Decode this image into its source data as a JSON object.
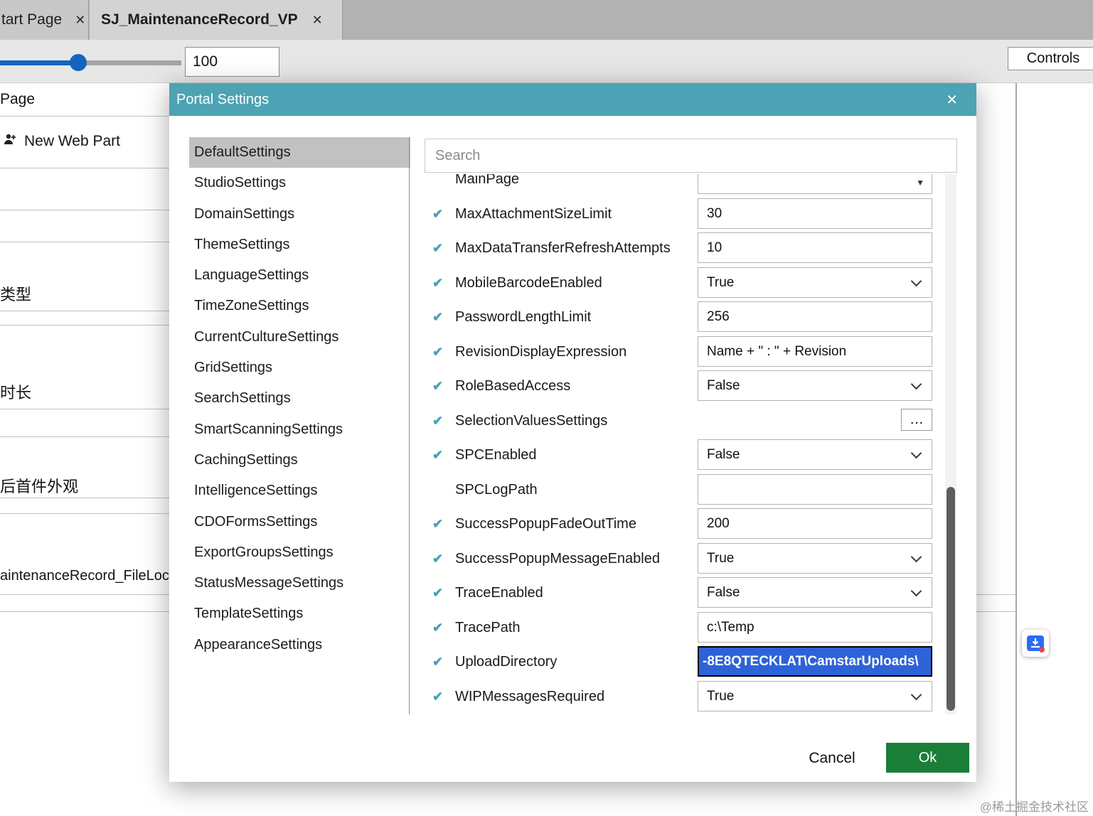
{
  "tabs": [
    {
      "label": "tart Page",
      "active": false
    },
    {
      "label": "SJ_MaintenanceRecord_VP",
      "active": true
    }
  ],
  "toolbar": {
    "zoom_value": "100",
    "controls_label": "Controls"
  },
  "background": {
    "page_label": "Page",
    "new_web_part_label": "New Web Part",
    "type_label": "类型",
    "duration_label": "时长",
    "appearance_label": "后首件外观",
    "file_label": "aintenanceRecord_FileLoc"
  },
  "icons": {
    "close": "✕",
    "check": "✔",
    "ellipsis": "…",
    "dropdown_arrow": "▼"
  },
  "dialog": {
    "title": "Portal Settings",
    "search_placeholder": "Search",
    "categories": [
      {
        "label": "DefaultSettings",
        "selected": true
      },
      {
        "label": "StudioSettings",
        "selected": false
      },
      {
        "label": "DomainSettings",
        "selected": false
      },
      {
        "label": "ThemeSettings",
        "selected": false
      },
      {
        "label": "LanguageSettings",
        "selected": false
      },
      {
        "label": "TimeZoneSettings",
        "selected": false
      },
      {
        "label": "CurrentCultureSettings",
        "selected": false
      },
      {
        "label": "GridSettings",
        "selected": false
      },
      {
        "label": "SearchSettings",
        "selected": false
      },
      {
        "label": "SmartScanningSettings",
        "selected": false
      },
      {
        "label": "CachingSettings",
        "selected": false
      },
      {
        "label": "IntelligenceSettings",
        "selected": false
      },
      {
        "label": "CDOFormsSettings",
        "selected": false
      },
      {
        "label": "ExportGroupsSettings",
        "selected": false
      },
      {
        "label": "StatusMessageSettings",
        "selected": false
      },
      {
        "label": "TemplateSettings",
        "selected": false
      },
      {
        "label": "AppearanceSettings",
        "selected": false
      }
    ],
    "settings": [
      {
        "label": "MainPage",
        "checked": false,
        "control": "select",
        "value": "",
        "clipped": true
      },
      {
        "label": "MaxAttachmentSizeLimit",
        "checked": true,
        "control": "text",
        "value": "30"
      },
      {
        "label": "MaxDataTransferRefreshAttempts",
        "checked": true,
        "control": "text",
        "value": "10"
      },
      {
        "label": "MobileBarcodeEnabled",
        "checked": true,
        "control": "select",
        "value": "True"
      },
      {
        "label": "PasswordLengthLimit",
        "checked": true,
        "control": "text",
        "value": "256"
      },
      {
        "label": "RevisionDisplayExpression",
        "checked": true,
        "control": "text",
        "value": "Name + \" : \" + Revision"
      },
      {
        "label": "RoleBasedAccess",
        "checked": true,
        "control": "select",
        "value": "False"
      },
      {
        "label": "SelectionValuesSettings",
        "checked": true,
        "control": "ellipsis",
        "value": "…"
      },
      {
        "label": "SPCEnabled",
        "checked": true,
        "control": "select",
        "value": "False"
      },
      {
        "label": "SPCLogPath",
        "checked": false,
        "control": "text",
        "value": ""
      },
      {
        "label": "SuccessPopupFadeOutTime",
        "checked": true,
        "control": "text",
        "value": "200"
      },
      {
        "label": "SuccessPopupMessageEnabled",
        "checked": true,
        "control": "select",
        "value": "True"
      },
      {
        "label": "TraceEnabled",
        "checked": true,
        "control": "select",
        "value": "False"
      },
      {
        "label": "TracePath",
        "checked": true,
        "control": "text",
        "value": "c:\\Temp"
      },
      {
        "label": "UploadDirectory",
        "checked": true,
        "control": "text",
        "value": "-8E8QTECKLAT\\CamstarUploads\\",
        "selected": true
      },
      {
        "label": "WIPMessagesRequired",
        "checked": true,
        "control": "select",
        "value": "True"
      }
    ],
    "cancel_label": "Cancel",
    "ok_label": "Ok"
  },
  "watermark": "@稀土掘金技术社区"
}
